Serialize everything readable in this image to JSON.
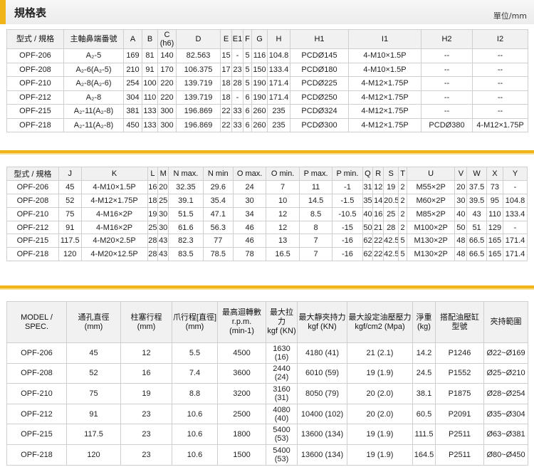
{
  "header": {
    "title": "規格表",
    "unit": "單位/mm"
  },
  "table1": {
    "headers": [
      "型式 / 規格",
      "主軸鼻端番號",
      "A",
      "B",
      "C\n(h6)",
      "D",
      "E",
      "E1",
      "F",
      "G",
      "H",
      "H1",
      "I1",
      "H2",
      "I2"
    ],
    "rows": [
      [
        "OPF-206",
        "A₂-5",
        "169",
        "81",
        "140",
        "82.563",
        "15",
        "-",
        "5",
        "116",
        "104.8",
        "PCDØ145",
        "4-M10×1.5P",
        "--",
        "--"
      ],
      [
        "OPF-208",
        "A₂-6(A₂-5)",
        "210",
        "91",
        "170",
        "106.375",
        "17",
        "23",
        "5",
        "150",
        "133.4",
        "PCDØ180",
        "4-M10×1.5P",
        "--",
        "--"
      ],
      [
        "OPF-210",
        "A₂-8(A₂-6)",
        "254",
        "100",
        "220",
        "139.719",
        "18",
        "28",
        "5",
        "190",
        "171.4",
        "PCDØ225",
        "4-M12×1.75P",
        "--",
        "--"
      ],
      [
        "OPF-212",
        "A₂-8",
        "304",
        "110",
        "220",
        "139.719",
        "18",
        "-",
        "6",
        "190",
        "171.4",
        "PCDØ250",
        "4-M12×1.75P",
        "--",
        "--"
      ],
      [
        "OPF-215",
        "A₂-11(A₂-8)",
        "381",
        "133",
        "300",
        "196.869",
        "22",
        "33",
        "6",
        "260",
        "235",
        "PCDØ324",
        "4-M12×1.75P",
        "--",
        "--"
      ],
      [
        "OPF-218",
        "A₂-11(A₂-8)",
        "450",
        "133",
        "300",
        "196.869",
        "22",
        "33",
        "6",
        "260",
        "235",
        "PCDØ300",
        "4-M12×1.75P",
        "PCDØ380",
        "4-M12×1.75P"
      ]
    ]
  },
  "table2": {
    "headers": [
      "型式 / 規格",
      "J",
      "K",
      "L",
      "M",
      "N max.",
      "N min",
      "O max.",
      "O min.",
      "P max.",
      "P min.",
      "Q",
      "R",
      "S",
      "T",
      "U",
      "V",
      "W",
      "X",
      "Y"
    ],
    "rows": [
      [
        "OPF-206",
        "45",
        "4-M10×1.5P",
        "16",
        "20",
        "32.35",
        "29.6",
        "24",
        "7",
        "11",
        "-1",
        "31",
        "12",
        "19",
        "2",
        "M55×2P",
        "20",
        "37.5",
        "73",
        "-"
      ],
      [
        "OPF-208",
        "52",
        "4-M12×1.75P",
        "18",
        "25",
        "39.1",
        "35.4",
        "30",
        "10",
        "14.5",
        "-1.5",
        "35",
        "14",
        "20.5",
        "2",
        "M60×2P",
        "30",
        "39.5",
        "95",
        "104.8"
      ],
      [
        "OPF-210",
        "75",
        "4-M16×2P",
        "19",
        "30",
        "51.5",
        "47.1",
        "34",
        "12",
        "8.5",
        "-10.5",
        "40",
        "16",
        "25",
        "2",
        "M85×2P",
        "40",
        "43",
        "110",
        "133.4"
      ],
      [
        "OPF-212",
        "91",
        "4-M16×2P",
        "25",
        "30",
        "61.6",
        "56.3",
        "46",
        "12",
        "8",
        "-15",
        "50",
        "21",
        "28",
        "2",
        "M100×2P",
        "50",
        "51",
        "129",
        "-"
      ],
      [
        "OPF-215",
        "117.5",
        "4-M20×2.5P",
        "28",
        "43",
        "82.3",
        "77",
        "46",
        "13",
        "7",
        "-16",
        "62",
        "22",
        "42.5",
        "5",
        "M130×2P",
        "48",
        "66.5",
        "165",
        "171.4"
      ],
      [
        "OPF-218",
        "120",
        "4-M20×12.5P",
        "28",
        "43",
        "83.5",
        "78.5",
        "78",
        "16.5",
        "7",
        "-16",
        "62",
        "22",
        "42.5",
        "5",
        "M130×2P",
        "48",
        "66.5",
        "165",
        "171.4"
      ]
    ]
  },
  "table3": {
    "headers": [
      "MODEL /\nSPEC.",
      "通孔直徑\n(mm)",
      "柱塞行程\n(mm)",
      "爪行程[直徑]\n(mm)",
      "最高迴轉數\nr.p.m.\n(min-1)",
      "最大拉力\nkgf (KN)",
      "最大靜夾持力\nkgf (KN)",
      "最大設定油壓壓力\nkgf/cm2 (Mpa)",
      "淨重\n(kg)",
      "搭配油壓缸 型號",
      "夾持範圍"
    ],
    "rows": [
      [
        "OPF-206",
        "45",
        "12",
        "5.5",
        "4500",
        "1630\n(16)",
        "4180 (41)",
        "21 (2.1)",
        "14.2",
        "P1246",
        "Ø22~Ø169"
      ],
      [
        "OPF-208",
        "52",
        "16",
        "7.4",
        "3600",
        "2440\n(24)",
        "6010 (59)",
        "19 (1.9)",
        "24.5",
        "P1552",
        "Ø25~Ø210"
      ],
      [
        "OPF-210",
        "75",
        "19",
        "8.8",
        "3200",
        "3160\n(31)",
        "8050 (79)",
        "20 (2.0)",
        "38.1",
        "P1875",
        "Ø28~Ø254"
      ],
      [
        "OPF-212",
        "91",
        "23",
        "10.6",
        "2500",
        "4080\n(40)",
        "10400 (102)",
        "20 (2.0)",
        "60.5",
        "P2091",
        "Ø35~Ø304"
      ],
      [
        "OPF-215",
        "117.5",
        "23",
        "10.6",
        "1800",
        "5400\n(53)",
        "13600 (134)",
        "19 (1.9)",
        "111.5",
        "P2511",
        "Ø63~Ø381"
      ],
      [
        "OPF-218",
        "120",
        "23",
        "10.6",
        "1500",
        "5400\n(53)",
        "13600 (134)",
        "19 (1.9)",
        "164.5",
        "P2511",
        "Ø80~Ø450"
      ]
    ]
  }
}
